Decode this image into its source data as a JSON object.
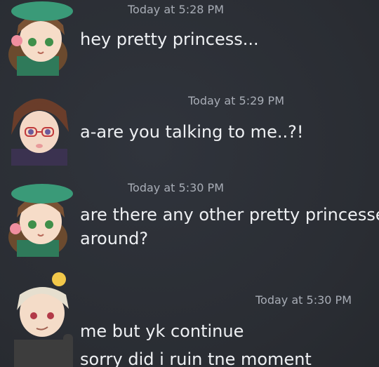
{
  "messages": [
    {
      "timestamp": "Today at 5:28 PM",
      "lines": [
        "hey pretty princess..."
      ],
      "avatar": "girl-green-beret-avatar"
    },
    {
      "timestamp": "Today at 5:29 PM",
      "lines": [
        "a-are you talking to me..?!"
      ],
      "avatar": "boy-glasses-avatar"
    },
    {
      "timestamp": "Today at 5:30 PM",
      "lines": [
        "are there any other pretty princesse",
        "around?"
      ],
      "avatar": "girl-green-beret-avatar"
    },
    {
      "timestamp": "Today at 5:30 PM",
      "lines": [
        "me but yk continue",
        "sorry did i ruin tne moment"
      ],
      "avatar": "blond-boy-chick-avatar"
    }
  ],
  "colors": {
    "background": "#2c2f36",
    "text": "#eef0f3",
    "timestamp": "#a8adb6"
  }
}
